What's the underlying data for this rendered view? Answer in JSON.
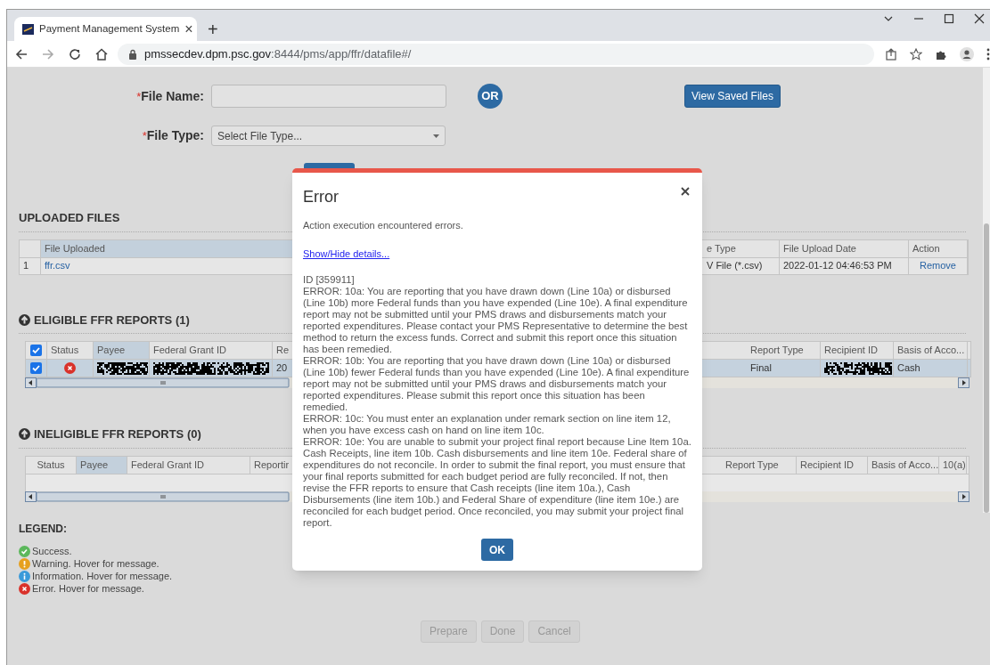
{
  "browser": {
    "tab_title": "Payment Management System",
    "tab_close": "×",
    "new_tab": "+",
    "url_host": "pmssecdev.dpm.psc.gov",
    "url_path": ":8444/pms/app/ffr/datafile#/"
  },
  "form": {
    "file_name": {
      "required_mark": "*",
      "label": "File Name:"
    },
    "or_badge": "OR",
    "view_saved_button": "View Saved Files",
    "file_type": {
      "required_mark": "*",
      "label": "File Type:",
      "placeholder": "Select File Type..."
    }
  },
  "uploaded_files": {
    "title": "UPLOADED FILES",
    "columns": [
      {
        "kind": "blank"
      },
      {
        "label": "File Uploaded",
        "sorted": true
      },
      {
        "label": "e Type",
        "sorted": false
      },
      {
        "label": "File Upload Date",
        "sorted": false
      },
      {
        "label": "Action",
        "sorted": false
      }
    ],
    "rows": [
      {
        "selected": false,
        "cells": [
          {
            "kind": "text",
            "text": "1"
          },
          {
            "kind": "link",
            "text": "ffr.csv"
          },
          {
            "kind": "text",
            "text": "V File (*.csv)"
          },
          {
            "kind": "text",
            "text": "2022-01-12 04:46:53 PM"
          },
          {
            "kind": "link",
            "text": "Remove"
          }
        ]
      }
    ]
  },
  "eligible_reports": {
    "title": "ELIGIBLE FFR REPORTS (1)",
    "columns": [
      {
        "kind": "checkbox",
        "checked": true
      },
      {
        "label": "Status",
        "sorted": false
      },
      {
        "label": "Payee",
        "sorted": true
      },
      {
        "label": "Federal Grant ID",
        "sorted": false
      },
      {
        "label": "Re",
        "sorted": false
      },
      {
        "label": "Report Type",
        "sorted": false
      },
      {
        "label": "Recipient ID",
        "sorted": false
      },
      {
        "label": "Basis of Acco...",
        "sorted": false
      }
    ],
    "rows": [
      {
        "selected": true,
        "cells": [
          {
            "kind": "checkbox",
            "checked": true
          },
          {
            "kind": "error"
          },
          {
            "kind": "redacted"
          },
          {
            "kind": "redacted"
          },
          {
            "kind": "text",
            "text": "20"
          },
          {
            "kind": "text",
            "text": "Final"
          },
          {
            "kind": "redacted"
          },
          {
            "kind": "text",
            "text": "Cash"
          }
        ]
      }
    ]
  },
  "ineligible_reports": {
    "title": "INELIGIBLE FFR REPORTS (0)",
    "columns": [
      {
        "label": "Status",
        "sorted": false
      },
      {
        "label": "Payee",
        "sorted": true
      },
      {
        "label": "Federal Grant ID",
        "sorted": false
      },
      {
        "label": "Reportir",
        "sorted": false
      },
      {
        "label": "Report Type",
        "sorted": false
      },
      {
        "label": "Recipient ID",
        "sorted": false
      },
      {
        "label": "Basis of Acco...",
        "sorted": false
      },
      {
        "label": "10(a)",
        "sorted": false
      }
    ]
  },
  "legend": {
    "title": "LEGEND:",
    "items": [
      {
        "kind": "success",
        "text": "Success."
      },
      {
        "kind": "warning",
        "text": "Warning. Hover for message."
      },
      {
        "kind": "info",
        "text": "Information. Hover for message."
      },
      {
        "kind": "error",
        "text": "Error. Hover for message."
      }
    ]
  },
  "footer_buttons": [
    {
      "label": "Prepare",
      "disabled": true
    },
    {
      "label": "Done",
      "disabled": true
    },
    {
      "label": "Cancel",
      "disabled": true
    }
  ],
  "error_dialog": {
    "title": "Error",
    "message": "Action execution encountered errors.",
    "details_link": "Show/Hide details...",
    "details": [
      "ID [359911]",
      "ERROR: 10a: You are reporting that you have drawn down (Line 10a) or disbursed (Line 10b) more Federal funds than you have expended (Line 10e). A final expenditure report may not be submitted until your PMS draws and disbursements match your reported expenditures. Please contact your PMS Representative to determine the best method to return the excess funds. Correct and submit this report once this situation has been remedied.",
      "ERROR: 10b: You are reporting that you have drawn down (Line 10a) or disbursed (Line 10b) fewer Federal funds than you have expended (Line 10e). A final expenditure report may not be submitted until your PMS draws and disbursements match your reported expenditures. Please submit this report once this situation has been remedied.",
      "ERROR: 10c: You must enter an explanation under remark section on line item 12, when you have excess cash on hand on line item 10c.",
      "ERROR: 10e: You are unable to submit your project final report because Line Item 10a. Cash Receipts, line item 10b. Cash disbursements and line item 10e. Federal share of expenditures do not reconcile. In order to submit the final report, you must ensure that your final reports submitted for each budget period are fully reconciled. If not, then revise the FFR reports to ensure that Cash receipts (line item 10a.), Cash Disbursements (line item 10b.) and Federal Share of expenditure (line item 10e.) are reconciled for each budget period. Once reconciled, you may submit your project final report."
    ],
    "ok_button": "OK"
  }
}
